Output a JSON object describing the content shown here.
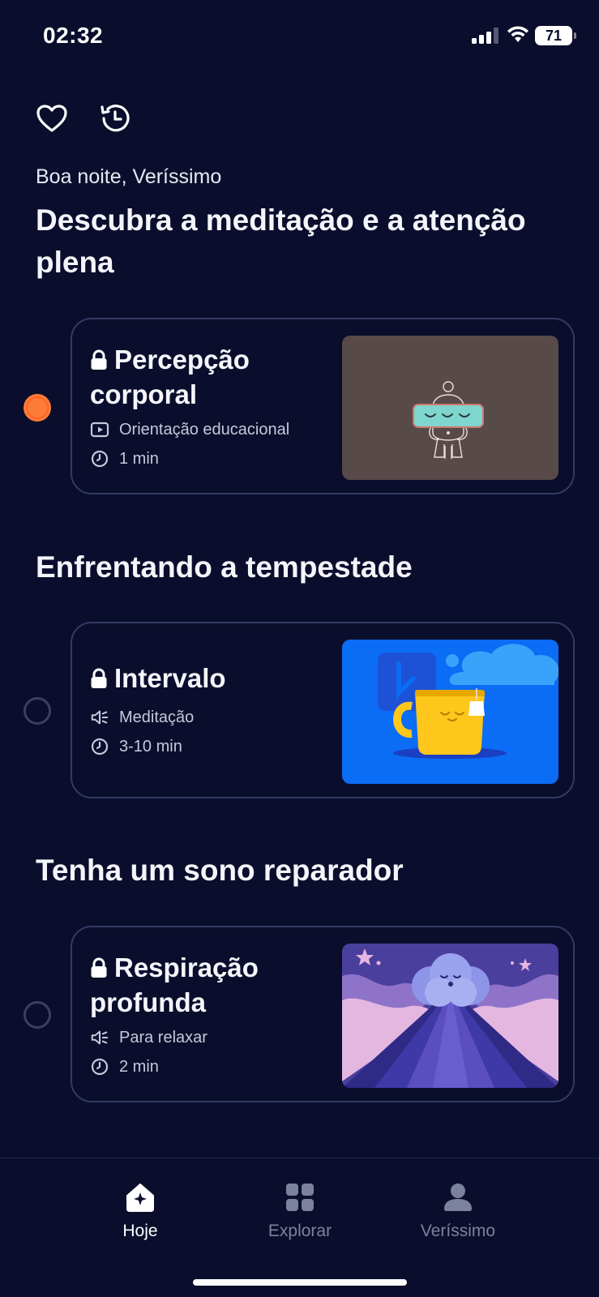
{
  "status_bar": {
    "time": "02:32",
    "battery": "71"
  },
  "header": {
    "greeting": "Boa noite, Veríssimo",
    "favorites_icon": "heart-icon",
    "history_icon": "history-icon"
  },
  "sections": [
    {
      "title": "Descubra a meditação e a atenção plena",
      "card": {
        "title": "Percepção corporal",
        "type_label": "Orientação educacional",
        "duration": "1 min",
        "locked": true,
        "completed_marker": true
      }
    },
    {
      "title": "Enfrentando a tempestade",
      "card": {
        "title": "Intervalo",
        "type_label": "Meditação",
        "duration": "3-10 min",
        "locked": true,
        "completed_marker": false
      }
    },
    {
      "title": "Tenha um sono reparador",
      "card": {
        "title": "Respiração profunda",
        "type_label": "Para relaxar",
        "duration": "2 min",
        "locked": true,
        "completed_marker": false
      }
    }
  ],
  "tabs": [
    {
      "label": "Hoje",
      "icon": "home-icon",
      "active": true
    },
    {
      "label": "Explorar",
      "icon": "grid-icon",
      "active": false
    },
    {
      "label": "Veríssimo",
      "icon": "profile-icon",
      "active": false
    }
  ],
  "colors": {
    "background": "#0a0e2c",
    "accent": "#ff7b3a",
    "card_border": "#333a66"
  }
}
